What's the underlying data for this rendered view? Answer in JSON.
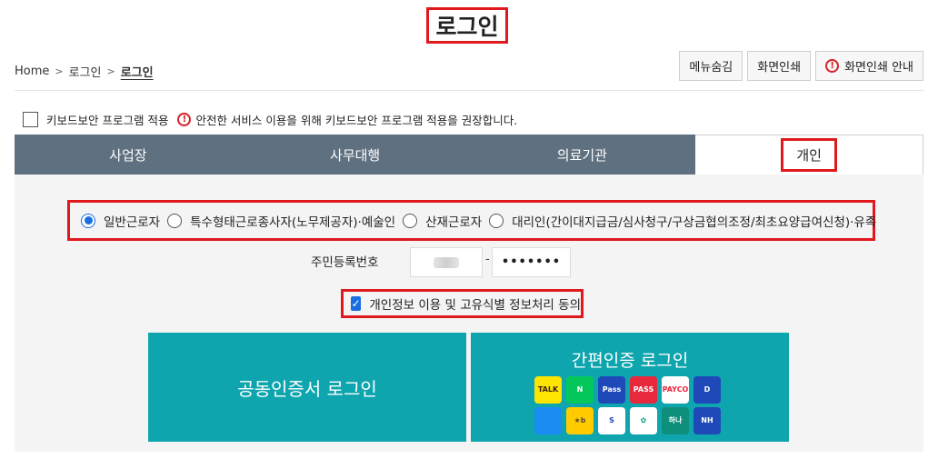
{
  "page": {
    "title": "로그인"
  },
  "breadcrumb": {
    "home": "Home",
    "level1": "로그인",
    "current": "로그인"
  },
  "top_buttons": {
    "hide_menu": "메뉴숨김",
    "print": "화면인쇄",
    "print_guide": "화면인쇄 안내"
  },
  "keyboard_security": {
    "label": "키보드보안 프로그램 적용",
    "notice": "안전한 서비스 이용을 위해 키보드보안 프로그램 적용을 권장합니다."
  },
  "tabs": [
    {
      "label": "사업장",
      "active": false
    },
    {
      "label": "사무대행",
      "active": false
    },
    {
      "label": "의료기관",
      "active": false
    },
    {
      "label": "개인",
      "active": true
    }
  ],
  "user_types": [
    {
      "label": "일반근로자",
      "selected": true
    },
    {
      "label": "특수형태근로종사자(노무제공자)·예술인",
      "selected": false
    },
    {
      "label": "산재근로자",
      "selected": false
    },
    {
      "label": "대리인(간이대지급금/심사청구/구상금협의조정/최초요양급여신청)·유족",
      "selected": false
    }
  ],
  "rrn": {
    "label": "주민등록번호",
    "separator": "-",
    "back_masked": "•••••••"
  },
  "consent": {
    "label": "개인정보 이용 및 고유식별 정보처리 동의",
    "checked": true
  },
  "login": {
    "cert_button": "공동인증서 로그인",
    "simple_auth_title": "간편인증 로그인",
    "providers": [
      {
        "name": "kakao-icon",
        "text": "TALK",
        "bg": "#fde500",
        "fg": "#3a1d1d"
      },
      {
        "name": "naver-icon",
        "text": "N",
        "bg": "#03c75a",
        "fg": "#ffffff"
      },
      {
        "name": "samsung-pass-icon",
        "text": "Pass",
        "bg": "#1f49b8",
        "fg": "#ffffff"
      },
      {
        "name": "pass-icon",
        "text": "PASS",
        "bg": "#e8283c",
        "fg": "#ffffff"
      },
      {
        "name": "payco-icon",
        "text": "PAYCO",
        "bg": "#ffffff",
        "fg": "#e8283c"
      },
      {
        "name": "dream-icon",
        "text": "D",
        "bg": "#1f49b8",
        "fg": "#ffffff"
      },
      {
        "name": "toss-icon",
        "text": "",
        "bg": "#1b8df2",
        "fg": "#ffffff"
      },
      {
        "name": "kb-icon",
        "text": "★b",
        "bg": "#ffcc00",
        "fg": "#5a4a3a"
      },
      {
        "name": "shinhan-icon",
        "text": "S",
        "bg": "#ffffff",
        "fg": "#1f49b8"
      },
      {
        "name": "banksalad-icon",
        "text": "✿",
        "bg": "#ffffff",
        "fg": "#0ea58a"
      },
      {
        "name": "hana-icon",
        "text": "하나",
        "bg": "#0e8f7c",
        "fg": "#ffffff"
      },
      {
        "name": "nh-icon",
        "text": "NH",
        "bg": "#1f49b8",
        "fg": "#ffffff"
      }
    ]
  },
  "colors": {
    "accent": "#0ea5ae",
    "tab_bg": "#5f7080",
    "highlight": "#e0191e",
    "radio": "#1a6fe0"
  }
}
